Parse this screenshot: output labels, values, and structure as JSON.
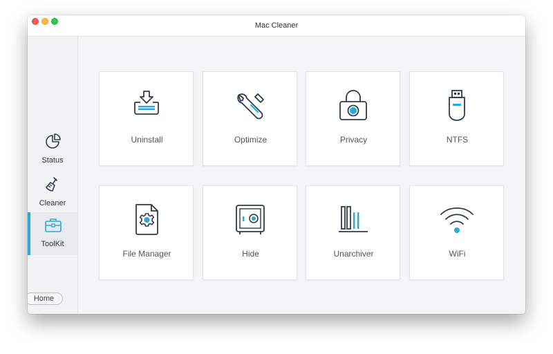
{
  "window": {
    "title": "Mac Cleaner"
  },
  "sidebar": {
    "items": [
      {
        "label": "Status",
        "icon": "pie-chart-icon"
      },
      {
        "label": "Cleaner",
        "icon": "broom-icon"
      },
      {
        "label": "ToolKit",
        "icon": "toolbox-icon",
        "active": true
      }
    ],
    "home_label": "Home"
  },
  "toolkit": {
    "cards": [
      {
        "label": "Uninstall",
        "icon": "uninstall-icon"
      },
      {
        "label": "Optimize",
        "icon": "wrench-icon"
      },
      {
        "label": "Privacy",
        "icon": "lock-icon"
      },
      {
        "label": "NTFS",
        "icon": "usb-drive-icon"
      },
      {
        "label": "File Manager",
        "icon": "file-gear-icon"
      },
      {
        "label": "Hide",
        "icon": "safe-icon"
      },
      {
        "label": "Unarchiver",
        "icon": "archive-icon"
      },
      {
        "label": "WiFi",
        "icon": "wifi-icon"
      }
    ]
  },
  "colors": {
    "accent": "#29a8e0",
    "icon_stroke": "#2f3a4a",
    "active_bar": "#29a8e0"
  }
}
